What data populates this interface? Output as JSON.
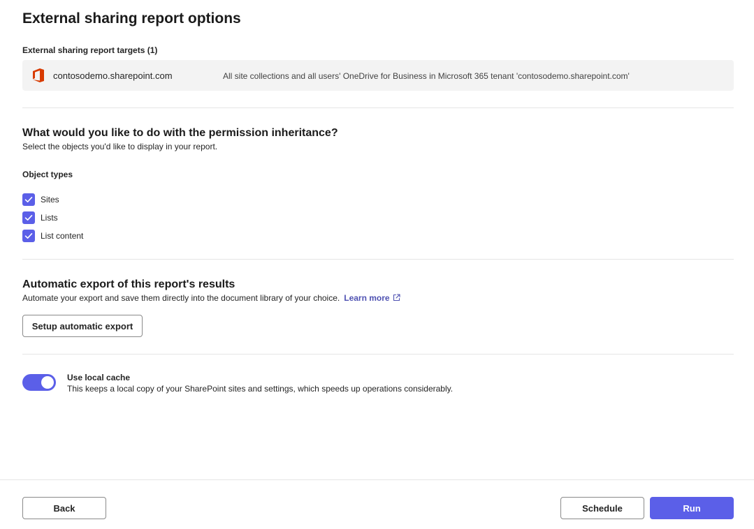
{
  "header": {
    "title": "External sharing report options"
  },
  "targets": {
    "label": "External sharing report targets (1)",
    "items": [
      {
        "icon": "office-icon",
        "name": "contosodemo.sharepoint.com",
        "description": "All site collections and all users' OneDrive for Business in Microsoft 365 tenant 'contosodemo.sharepoint.com'"
      }
    ]
  },
  "permissions": {
    "title": "What would you like to do with the permission inheritance?",
    "subtitle": "Select the objects you'd like to display in your report.",
    "object_types_label": "Object types",
    "options": [
      {
        "label": "Sites",
        "checked": true
      },
      {
        "label": "Lists",
        "checked": true
      },
      {
        "label": "List content",
        "checked": true
      }
    ]
  },
  "export": {
    "title": "Automatic export of this report's results",
    "subtitle": "Automate your export and save them directly into the document library of your choice.",
    "learn_more": "Learn more",
    "setup_button": "Setup automatic export"
  },
  "cache": {
    "enabled": true,
    "title": "Use local cache",
    "description": "This keeps a local copy of your SharePoint sites and settings, which speeds up operations considerably."
  },
  "footer": {
    "back": "Back",
    "schedule": "Schedule",
    "run": "Run"
  },
  "colors": {
    "accent": "#5b5fe8",
    "link": "#4f52b2",
    "office_red": "#d83b01"
  }
}
